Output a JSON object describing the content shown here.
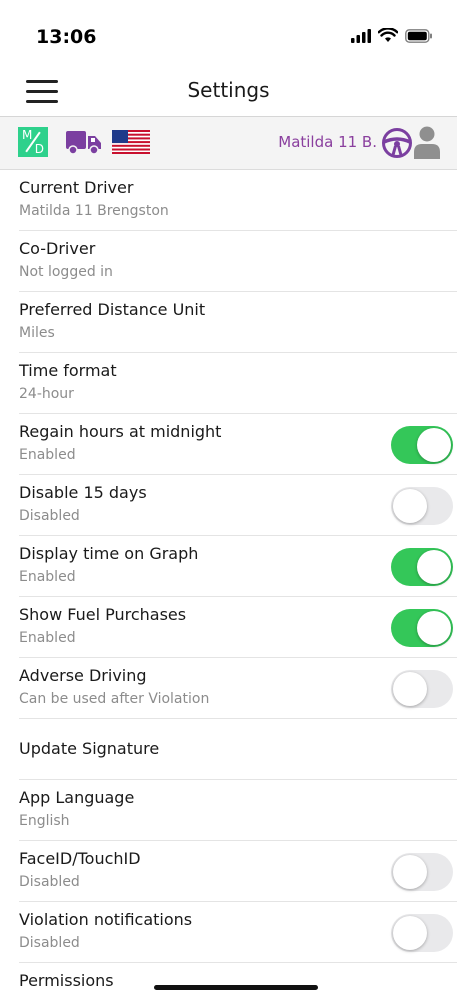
{
  "status": {
    "time": "13:06"
  },
  "header": {
    "title": "Settings"
  },
  "info_bar": {
    "md_top": "M",
    "md_bottom": "D",
    "driver_short": "Matilda 11 B.",
    "accent_color": "#8a3f9e",
    "md_color": "#2ed18c"
  },
  "settings": [
    {
      "label": "Current Driver",
      "value": "Matilda 11 Brengston"
    },
    {
      "label": "Co-Driver",
      "value": "Not logged in"
    },
    {
      "label": "Preferred Distance Unit",
      "value": "Miles"
    },
    {
      "label": "Time format",
      "value": "24-hour"
    },
    {
      "label": "Regain hours at midnight",
      "value": "Enabled",
      "toggle": true
    },
    {
      "label": "Disable 15 days",
      "value": "Disabled",
      "toggle": false
    },
    {
      "label": "Display time on Graph",
      "value": "Enabled",
      "toggle": true
    },
    {
      "label": "Show Fuel Purchases",
      "value": "Enabled",
      "toggle": true
    },
    {
      "label": "Adverse Driving",
      "value": "Can be used after Violation",
      "toggle": false
    },
    {
      "label": "Update Signature"
    },
    {
      "label": "App Language",
      "value": "English"
    },
    {
      "label": "FaceID/TouchID",
      "value": "Disabled",
      "toggle": false
    },
    {
      "label": "Violation notifications",
      "value": "Disabled",
      "toggle": false
    },
    {
      "label": "Permissions"
    }
  ],
  "icons": {
    "menu": "hamburger-menu-icon",
    "md": "md-logo-icon",
    "truck": "truck-icon",
    "flag": "us-flag-icon",
    "wheel": "steering-wheel-icon",
    "person": "person-icon"
  },
  "toggle_on_color": "#34c759"
}
